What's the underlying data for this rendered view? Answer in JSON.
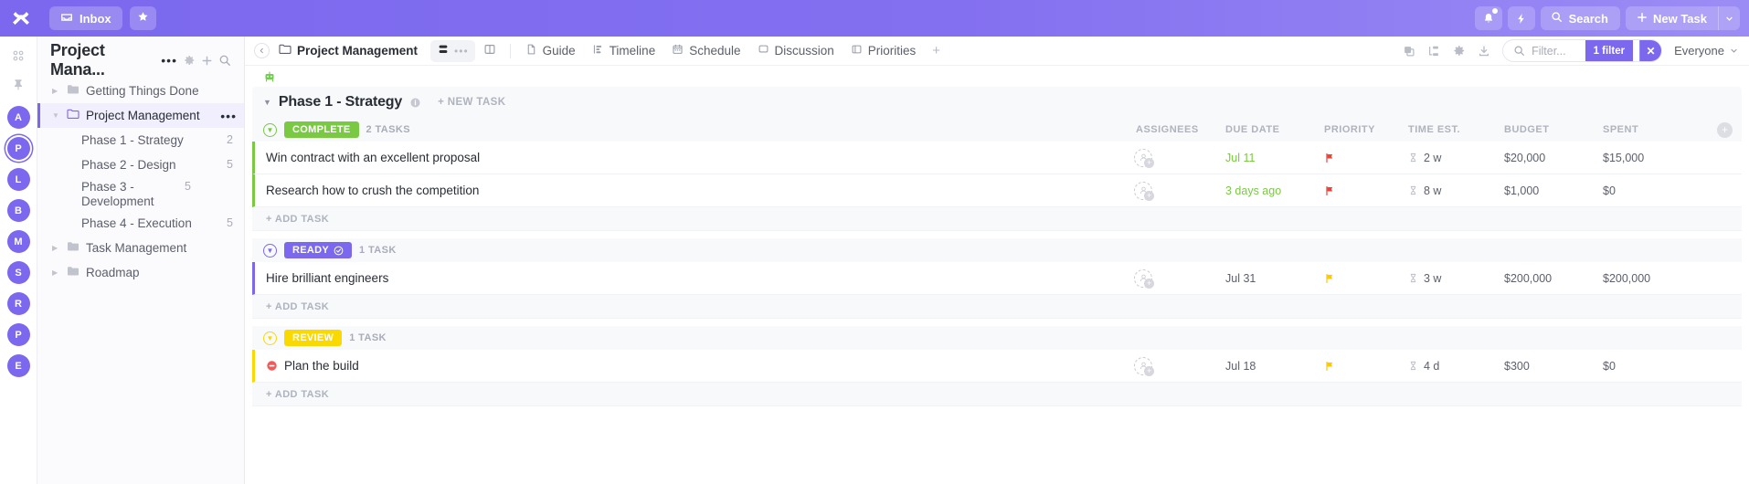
{
  "topbar": {
    "logo_icon": "clickup-logo-icon",
    "inbox_label": "Inbox",
    "inbox_icon": "inbox-icon",
    "favorite_icon": "star-icon",
    "notifications_icon": "bell-icon",
    "automation_icon": "lightning-bolt-icon",
    "search_label": "Search",
    "search_icon": "search-icon",
    "new_task_label": "New Task",
    "new_task_plus_icon": "plus-icon",
    "new_task_caret_icon": "chevron-down-icon",
    "accent_color": "#7b68ee"
  },
  "rail": {
    "apps_icon": "grid-apps-icon",
    "pin_icon": "pin-icon",
    "avatars": [
      {
        "initial": "A",
        "selected": false
      },
      {
        "initial": "P",
        "selected": true
      },
      {
        "initial": "L",
        "selected": false
      },
      {
        "initial": "B",
        "selected": false
      },
      {
        "initial": "M",
        "selected": false
      },
      {
        "initial": "S",
        "selected": false
      },
      {
        "initial": "R",
        "selected": false
      },
      {
        "initial": "P",
        "selected": false
      },
      {
        "initial": "E",
        "selected": false
      }
    ]
  },
  "sidebar": {
    "title": "Project Mana...",
    "dots_label": "•••",
    "settings_icon": "gear-icon",
    "add_icon": "plus-icon",
    "search_icon": "search-icon",
    "items": [
      {
        "label": "Getting Things Done",
        "type": "folder",
        "expanded": false,
        "active": false
      },
      {
        "label": "Project Management",
        "type": "folder",
        "expanded": true,
        "active": true
      },
      {
        "label": "Phase 1 - Strategy",
        "type": "list",
        "count": "2"
      },
      {
        "label": "Phase 2 - Design",
        "type": "list",
        "count": "5"
      },
      {
        "label": "Phase 3 - Development",
        "type": "list",
        "count": "5"
      },
      {
        "label": "Phase 4 - Execution",
        "type": "list",
        "count": "5"
      },
      {
        "label": "Task Management",
        "type": "folder",
        "expanded": false,
        "active": false
      },
      {
        "label": "Roadmap",
        "type": "folder",
        "expanded": false,
        "active": false
      }
    ]
  },
  "toolbar": {
    "collapse_icon": "chevron-left-icon",
    "breadcrumb": "Project Management",
    "breadcrumb_icon": "folder-icon",
    "view_list_icon": "list-view-icon",
    "view_more_icon": "ellipsis-icon",
    "view_board_icon": "board-view-icon",
    "tabs": [
      {
        "label": "Guide",
        "icon": "doc-icon"
      },
      {
        "label": "Timeline",
        "icon": "timeline-icon"
      },
      {
        "label": "Schedule",
        "icon": "calendar-icon"
      },
      {
        "label": "Discussion",
        "icon": "chat-icon"
      },
      {
        "label": "Priorities",
        "icon": "priorities-icon"
      }
    ],
    "add_tab_icon": "plus-icon",
    "right_icons": [
      "duplicate-icon",
      "subtasks-icon",
      "gear-icon",
      "download-icon"
    ],
    "filter_placeholder": "Filter...",
    "filter_search_icon": "search-icon",
    "filter_badge": "1 filter",
    "filter_clear_icon": "close-icon",
    "assignee_filter_label": "Everyone",
    "assignee_filter_caret": "chevron-down-icon"
  },
  "list": {
    "ai_icon": "robot-icon",
    "phase": {
      "title": "Phase 1 - Strategy",
      "caret_icon": "chevron-down-icon",
      "info_icon": "info-icon",
      "new_task_label": "+ NEW TASK"
    },
    "columns": [
      "ASSIGNEES",
      "DUE DATE",
      "PRIORITY",
      "TIME EST.",
      "BUDGET",
      "SPENT"
    ],
    "add_column_icon": "plus-circle-icon",
    "add_task_label": "+ ADD TASK",
    "groups": [
      {
        "status": "COMPLETE",
        "color": "#7ac943",
        "badge_check": false,
        "count": "2 TASKS",
        "caret_icon": "chevron-down-circle-icon",
        "tasks": [
          {
            "name": "Win contract with an excellent proposal",
            "lead_icon": null,
            "assignee_icon": "add-assignee-icon",
            "due": "Jul 11",
            "due_color": "#7ac943",
            "priority_color": "#e8443a",
            "priority_icon": "flag-icon",
            "time_icon": "hourglass-icon",
            "time": "2 w",
            "budget": "$20,000",
            "spent": "$15,000"
          },
          {
            "name": "Research how to crush the competition",
            "lead_icon": null,
            "assignee_icon": "add-assignee-icon",
            "due": "3 days ago",
            "due_color": "#7ac943",
            "priority_color": "#e8443a",
            "priority_icon": "flag-icon",
            "time_icon": "hourglass-icon",
            "time": "8 w",
            "budget": "$1,000",
            "spent": "$0"
          }
        ]
      },
      {
        "status": "READY",
        "color": "#7b68ee",
        "badge_check": true,
        "count": "1 TASK",
        "caret_icon": "chevron-down-circle-icon",
        "tasks": [
          {
            "name": "Hire brilliant engineers",
            "lead_icon": null,
            "assignee_icon": "add-assignee-icon",
            "due": "Jul 31",
            "due_color": "#5c5f6b",
            "priority_color": "#ffc800",
            "priority_icon": "flag-icon",
            "time_icon": "hourglass-icon",
            "time": "3 w",
            "budget": "$200,000",
            "spent": "$200,000"
          }
        ]
      },
      {
        "status": "REVIEW",
        "color": "#f9d900",
        "badge_check": false,
        "count": "1 TASK",
        "caret_icon": "chevron-down-circle-icon",
        "tasks": [
          {
            "name": "Plan the build",
            "lead_icon": "blocked-icon",
            "assignee_icon": "add-assignee-icon",
            "due": "Jul 18",
            "due_color": "#5c5f6b",
            "priority_color": "#ffc800",
            "priority_icon": "flag-icon",
            "time_icon": "hourglass-icon",
            "time": "4 d",
            "budget": "$300",
            "spent": "$0"
          }
        ]
      }
    ]
  }
}
